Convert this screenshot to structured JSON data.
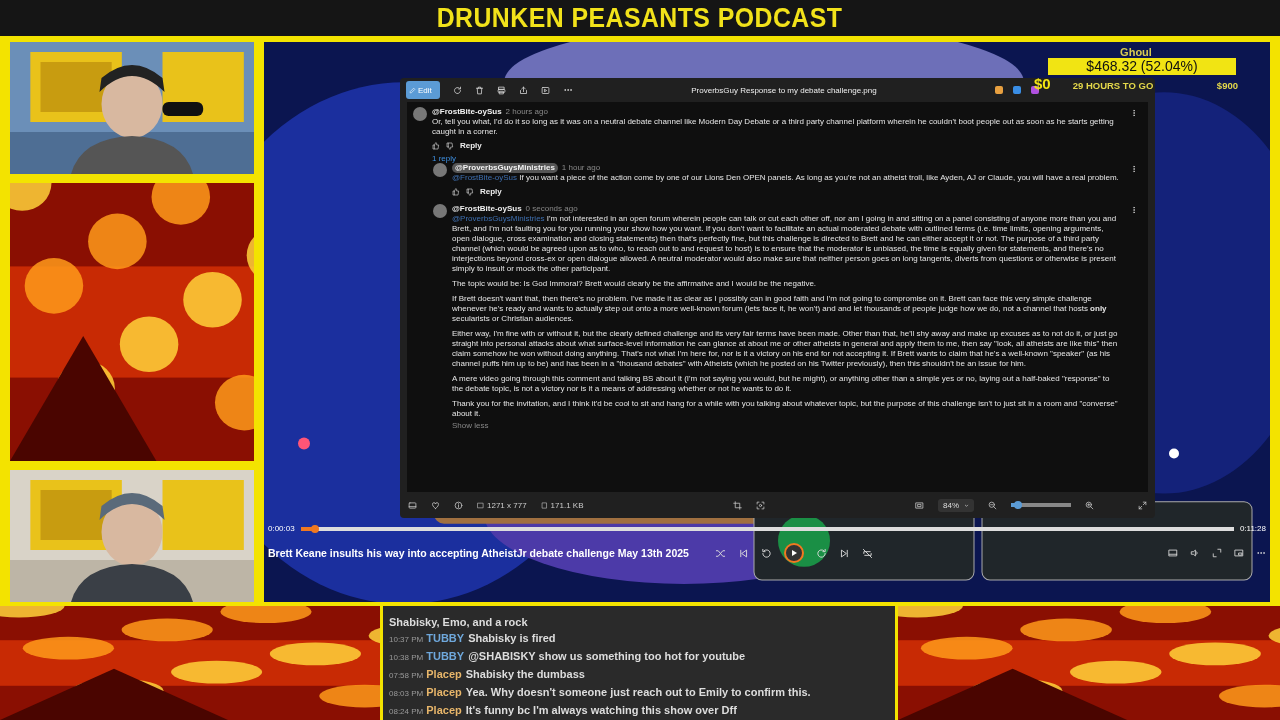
{
  "header": {
    "title": "DRUNKEN PEASANTS PODCAST"
  },
  "donation": {
    "name": "Ghoul",
    "amount": "$468.32 (52.04%)",
    "balance": "$0",
    "time_left": "29 HOURS TO GO",
    "goal": "$900"
  },
  "viewer": {
    "edit": "Edit",
    "title": "ProverbsGuy Response to my debate challenge.png",
    "comments": [
      {
        "author": "@FrostBite-oySus",
        "owner": false,
        "age": "2 hours ago",
        "paragraphs": [
          "Or, tell you what, I'd do it so long as it was on a neutral debate channel like Modern Day Debate or a third party channel platform wherein he couldn't boot people out as soon as he starts getting caught in a corner."
        ],
        "reply": "Reply",
        "replies_toggle": "1 reply",
        "children": [
          {
            "author": "@ProverbsGuysMinistries",
            "owner": true,
            "age": "1 hour ago",
            "mention": "@FrostBite-oySus",
            "paragraphs": [
              "If you want a piece of the action come by one of our Lions Den OPEN panels. As long as you're not an atheist troll, like Ayden, AJ or Claude, you will have a real problem."
            ],
            "reply": "Reply"
          },
          {
            "author": "@FrostBite-oySus",
            "owner": false,
            "age": "0 seconds ago",
            "mention": "@ProverbsGuysMinistries",
            "paragraphs": [
              "I'm not interested in an open forum wherein people can talk or cut each other off, nor am I going in and sitting on a panel consisting of anyone more than you and Brett, and I'm not faulting you for you running your show how you want. If you don't want to facilitate an actual moderated debate with outlined terms (i.e. time limits, opening arguments, open dialogue, cross examination and closing statements) then that's perfectly fine, but this challenge is directed to Brett and he can either accept it or not. The purpose of a third party channel (which would be agreed upon as to who, to reach out to and request to host) is to ensure that the moderator is unbiased, the time is equally given for statements, and there's no interjections beyond cross-ex or open dialogue allowed. A neutral moderator would also make sure that neither person goes on long tangents, diverts from questions or otherwise is present simply to insult or mock the other participant.",
              "The topic would be: Is God Immoral? Brett would clearly be the affirmative and I would be the negative.",
              "If Brett doesn't want that, then there's no problem. I've made it as clear as I possibly can in good faith and I'm not going to compromise on it. Brett can face this very simple challenge whenever he's ready and wants to actually step out onto a more well-known forum (lets face it, he won't) and and let thousands of people judge how we do, not a channel that hosts **only** secularists or Christian audiences.",
              "Either way, I'm fine with or without it, but the clearly defined challenge and its very fair terms have been made. Other than that, he'll shy away and make up excuses as to not do it, or just go straight into personal attacks about what surface-level information he can glance at about me or other atheists in general and apply them to me, then say \"look, all atheists are like this\" then claim somehow he won without doing anything. That's not what I'm here for, nor is it a victory on his end for not accepting it. If Brett wants to claim that he's a well-known \"speaker\" (as his channel puffs him up to be) and has been in a \"thousand debates\" with Atheists (which he posted on his Twitter previously), then this shouldn't be an issue for him.",
              "A mere video going through this comment and talking BS about it (I'm not saying you would, but he might), or anything other than a simple yes or no, laying out a half-baked \"response\" to the debate topic, is not a victory nor is it a means of addressing whether or not he wants to do it.",
              "Thank you for the invitation, and I think it'd be cool to sit and hang for a while with you talking about whatever topic, but the purpose of this challenge isn't to just sit in a room and \"converse\" about it."
            ],
            "show_less": "Show less"
          }
        ]
      }
    ],
    "dimensions": "1271 x 777",
    "file_size": "171.1 KB",
    "zoom": "84%",
    "zoom_slider": {
      "level": 0.12
    }
  },
  "player": {
    "elapsed": "0:00:03",
    "duration": "0:11:28",
    "progress": {
      "level": 0.015
    },
    "playing": false,
    "title": "Brett Keane insults his way into accepting AtheistJr debate challenge May 13th 2025"
  },
  "chat": [
    {
      "kind": "continuation",
      "message": "Shabisky, Emo, and a rock"
    },
    {
      "kind": "message",
      "time": "10:37 PM",
      "user": "TUBBY",
      "color": "#6fa8dc",
      "message": "Shabisky is fired"
    },
    {
      "kind": "message",
      "time": "10:38 PM",
      "user": "TUBBY",
      "color": "#6fa8dc",
      "message": "@SHABISKY show us something too hot for youtube"
    },
    {
      "kind": "message",
      "time": "07:58 PM",
      "user": "Placep",
      "color": "#e8b66a",
      "message": "Shabisky the dumbass"
    },
    {
      "kind": "message",
      "time": "08:03 PM",
      "user": "Placep",
      "color": "#e8b66a",
      "message": "Yea. Why doesn't someone just reach out to Emily to confirm this."
    },
    {
      "kind": "message",
      "time": "08:24 PM",
      "user": "Placep",
      "color": "#e8b66a",
      "message": "It's funny bc I'm always watching this show over Dff"
    }
  ]
}
